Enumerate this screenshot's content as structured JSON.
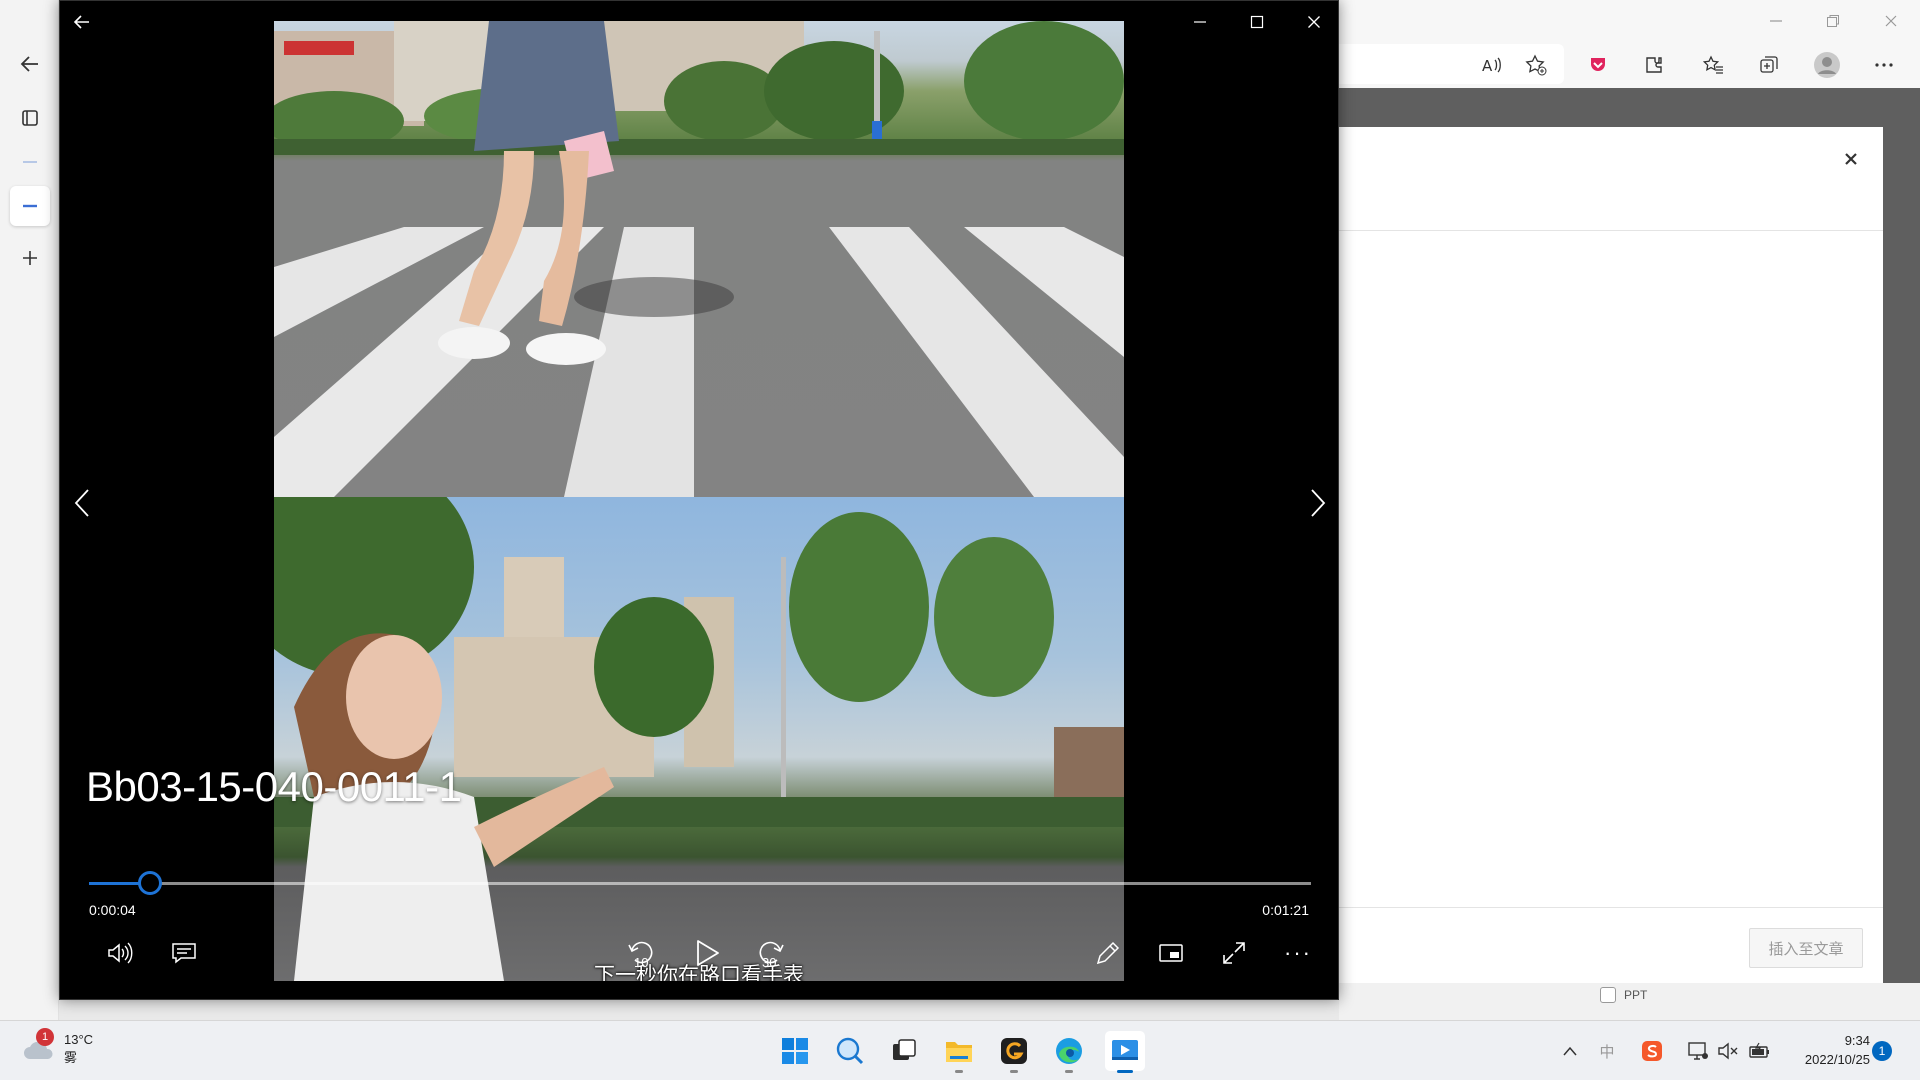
{
  "browser": {
    "sidebar_icons": [
      "back-arrow-icon",
      "tab-actions-icon",
      "minus-icon",
      "minus-icon",
      "plus-icon"
    ],
    "toolbar_icons": [
      "read-aloud-icon",
      "add-favorite-icon",
      "pocket-icon",
      "extensions-icon",
      "favorites-icon",
      "collections-icon",
      "profile-icon",
      "more-icon"
    ],
    "dialog": {
      "close_label": "×",
      "insert_button": "插入至文章"
    },
    "under_checkbox_label": "PPT"
  },
  "player": {
    "video_title": "Bb03-15-040-0011-1",
    "current_time": "0:00:04",
    "duration": "0:01:21",
    "progress": 0.05,
    "subtitle": "下一秒你在路口看手表",
    "skip_back_label": "10",
    "skip_forward_label": "30",
    "more_label": "···"
  },
  "taskbar": {
    "weather": {
      "temperature": "13°C",
      "condition": "雾",
      "badge": "1"
    },
    "tray_ime": "中",
    "clock_time": "9:34",
    "clock_date": "2022/10/25",
    "notification_count": "1"
  },
  "colors": {
    "accent": "#1e73d6",
    "taskbar": "#eef0f3",
    "badge_red": "#d13438",
    "windows_blue": "#0067c0"
  }
}
